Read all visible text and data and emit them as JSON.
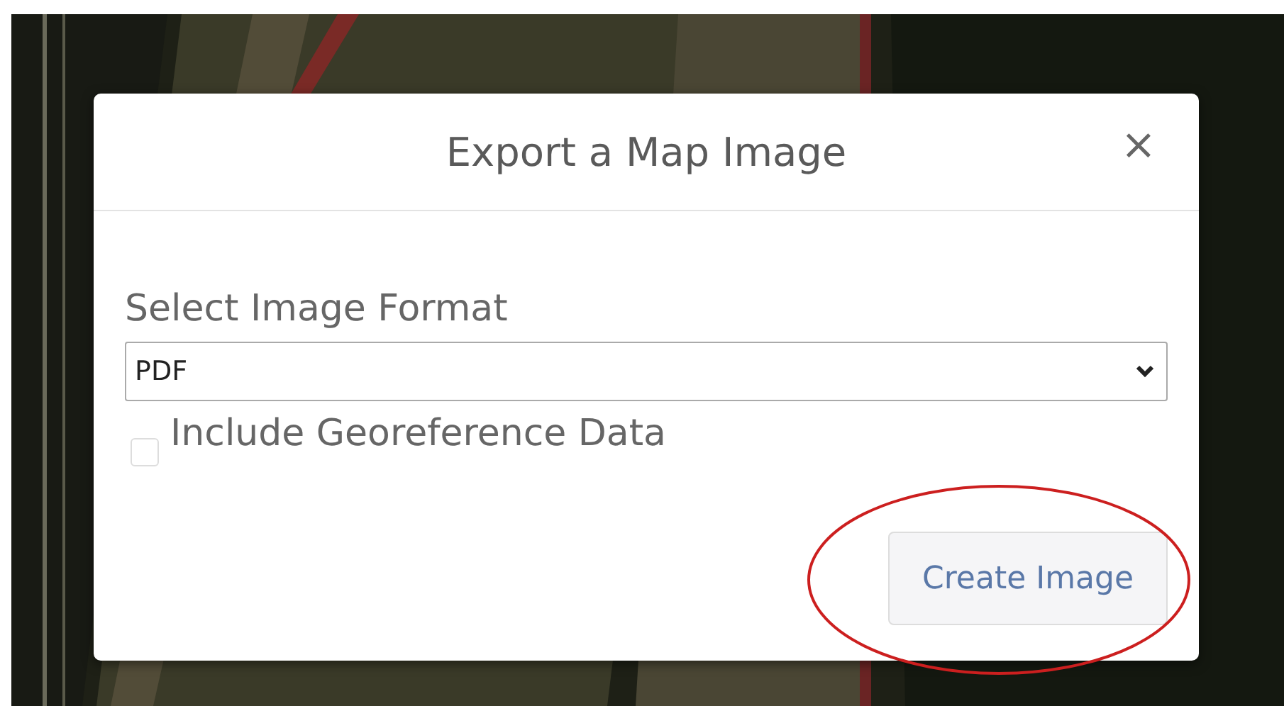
{
  "dialog": {
    "title": "Export a Map Image",
    "close": "×",
    "format_label": "Select Image Format",
    "format_select": {
      "value": "PDF"
    },
    "georeference": {
      "label": "Include Georeference Data",
      "checked": false
    },
    "buttons": [
      {
        "label": "Create Image",
        "highlighted": true
      }
    ]
  }
}
